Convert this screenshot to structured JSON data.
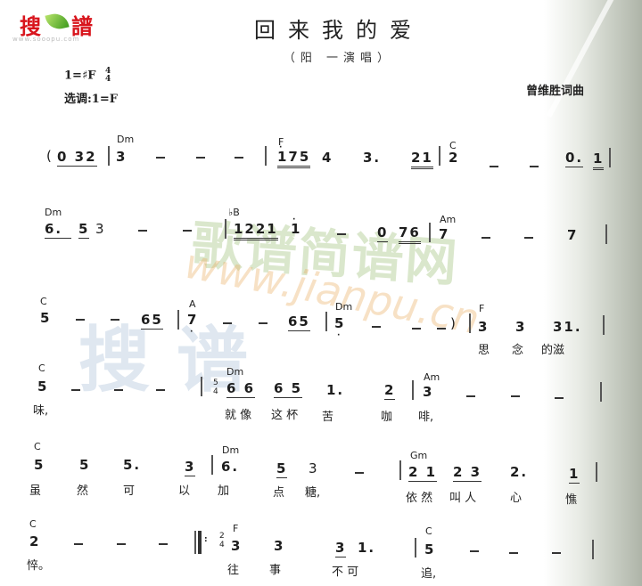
{
  "logo": {
    "char1": "搜",
    "char2": "譜",
    "url": "www.sooopu.com"
  },
  "header": {
    "title": "回来我的爱",
    "singer": "（阳  一演唱）",
    "key": "1=♯F",
    "time_top": "4",
    "time_bottom": "4",
    "key_select": "选调:1=F",
    "composer": "曾维胜词曲"
  },
  "watermark": {
    "green": "歌谱简谱网",
    "orange": "www.jianpu.cn",
    "blue": "搜谱"
  },
  "score": {
    "line1": {
      "chords": [
        "Dm",
        "F",
        "C"
      ],
      "notes": [
        "(",
        "0 32",
        "3",
        "175",
        "4",
        "3.",
        "21",
        "2",
        "0.",
        "1"
      ]
    },
    "line2": {
      "chords": [
        "Dm",
        "♭B",
        "Am"
      ],
      "notes": [
        "6.",
        "5",
        "3",
        "1221",
        "1",
        "0",
        "76",
        "7",
        "7"
      ]
    },
    "line3": {
      "chords": [
        "C",
        "A",
        "Dm",
        "F"
      ],
      "notes": [
        "5",
        "65",
        "7",
        "65",
        "5",
        ")",
        "3",
        "3",
        "31."
      ],
      "lyrics": [
        "思",
        "念",
        "的滋"
      ]
    },
    "line4": {
      "chords": [
        "C",
        "Dm",
        "Am"
      ],
      "notes": [
        "5",
        "5/6",
        "6 6",
        "6 5",
        "1.",
        "2",
        "3"
      ],
      "lyrics": [
        "味,",
        "就 像",
        "这 杯",
        "苦",
        "咖",
        "啡,"
      ]
    },
    "line5": {
      "chords": [
        "C",
        "Dm",
        "Gm"
      ],
      "notes": [
        "5",
        "5",
        "5.",
        "3",
        "6.",
        "5",
        "3",
        "2 1",
        "2 3",
        "2.",
        "1"
      ],
      "lyrics": [
        "虽",
        "然",
        "可",
        "以",
        "加",
        "点",
        "糖,",
        "依 然",
        "叫 人",
        "心",
        "憔"
      ]
    },
    "line6": {
      "chords": [
        "C",
        "F",
        "C"
      ],
      "notes": [
        "2",
        "2/2",
        "3",
        "3",
        "3",
        "1.",
        "5"
      ],
      "lyrics": [
        "悴。",
        "往",
        "事",
        "不 可",
        "追,"
      ]
    }
  }
}
